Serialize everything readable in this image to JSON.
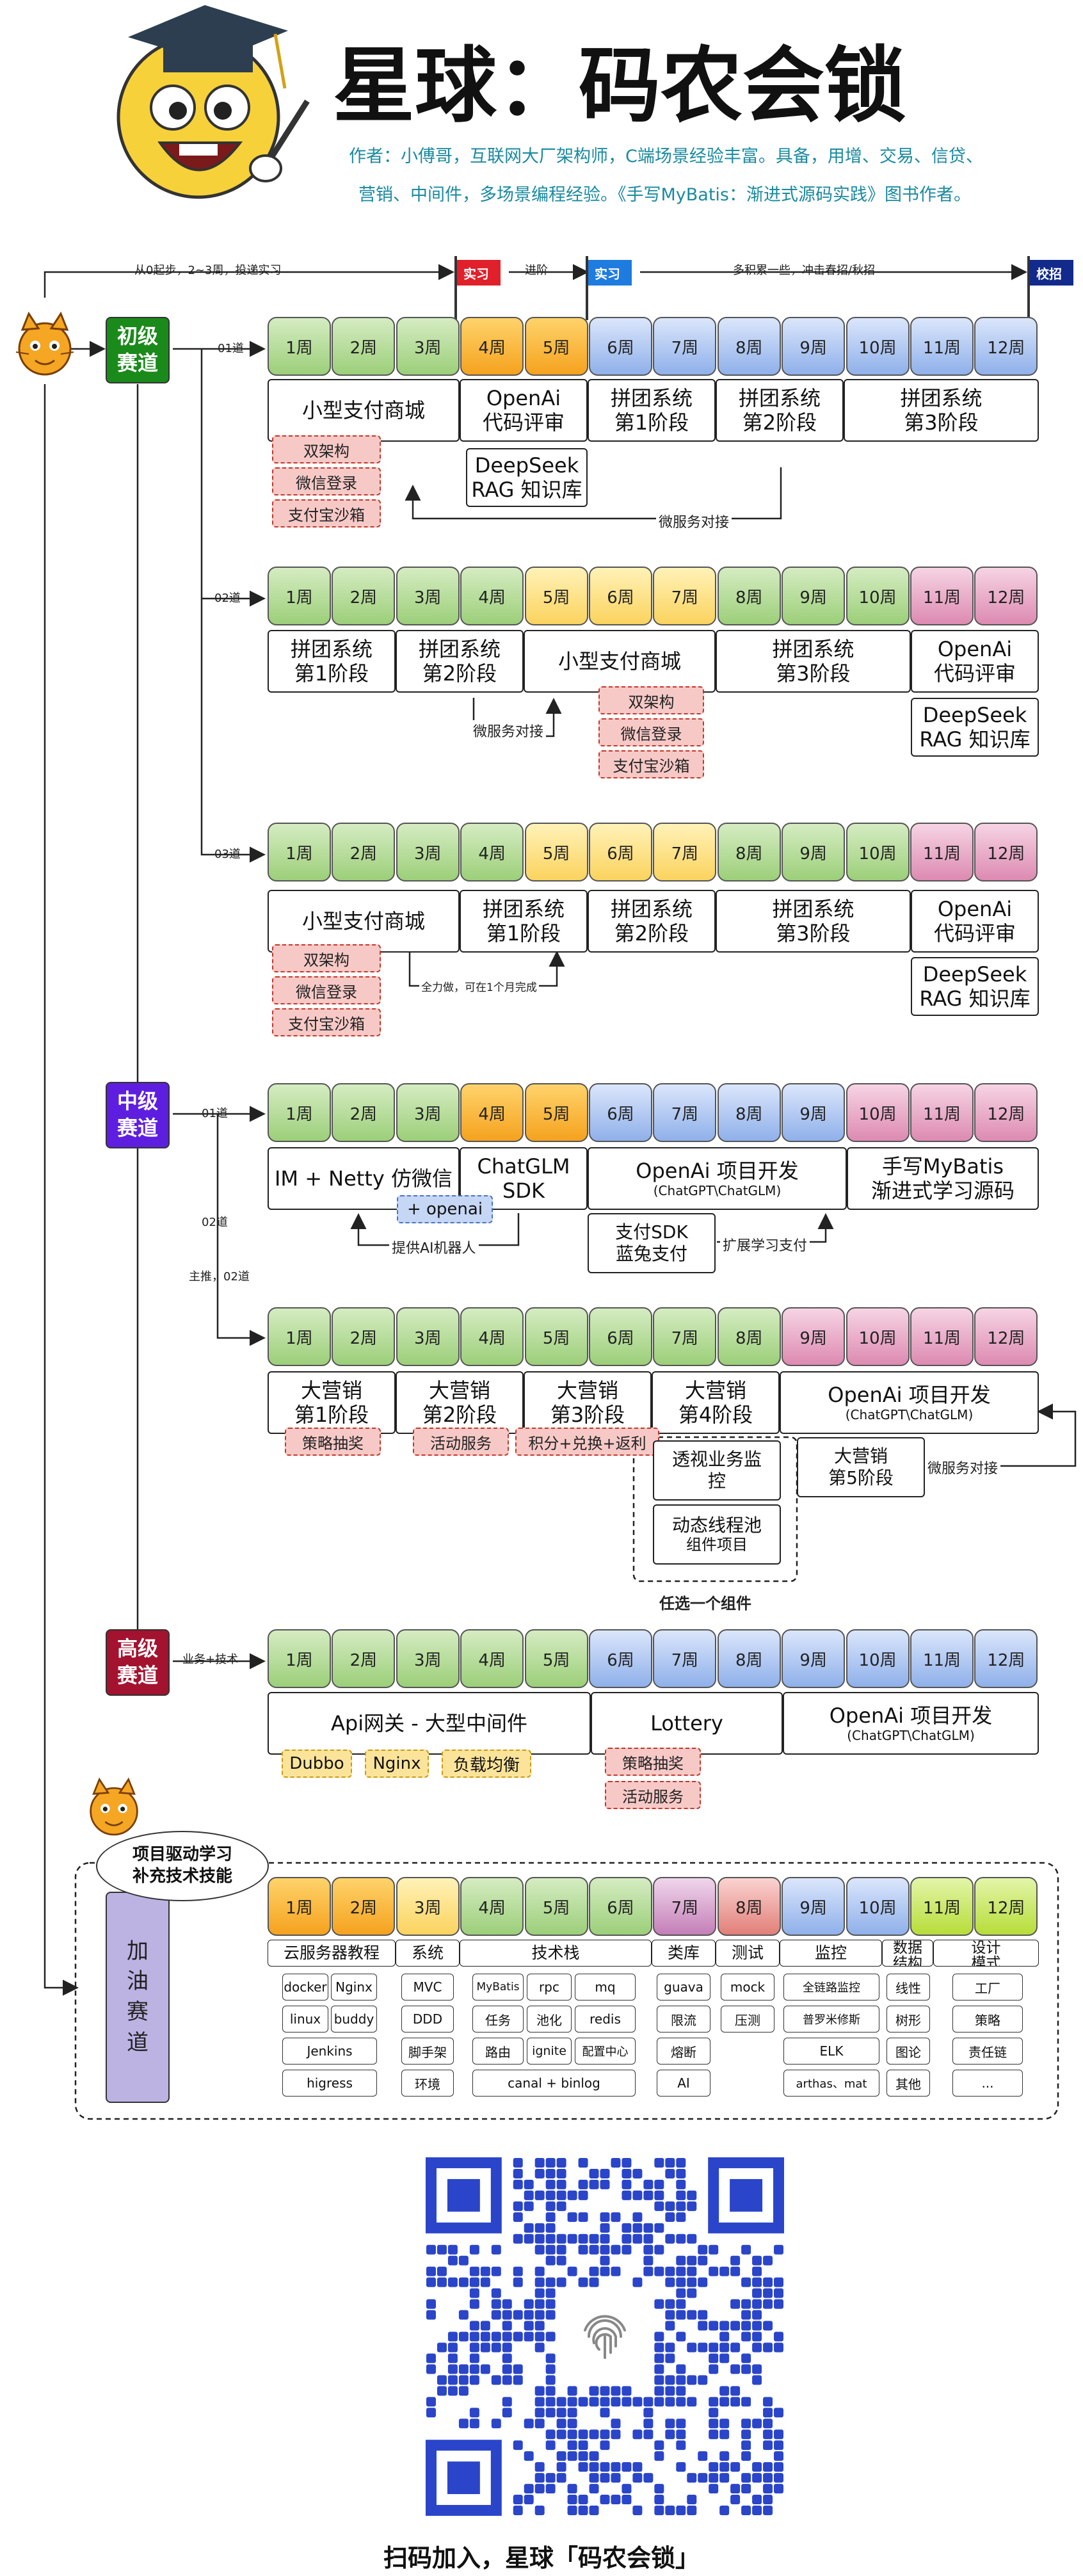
{
  "header": {
    "title": "星球：码农会锁",
    "intro_line1": "作者：小傅哥，互联网大厂架构师，C端场景经验丰富。具备，用增、交易、信贷、",
    "intro_line2": "营销、中间件，多场景编程经验。《手写MyBatis：渐进式源码实践》图书作者。"
  },
  "flags": {
    "intern1": "实习",
    "intern2": "实习",
    "campus": "校招",
    "start_note": "从0起步，2~3周，投递实习",
    "advance_note": "进阶",
    "accum_note": "多积累一些，冲击春招/秋招"
  },
  "tracks": {
    "junior": "初级\n赛道",
    "middle": "中级\n赛道",
    "senior": "高级\n赛道",
    "boost": "加\n油\n赛\n道"
  },
  "route_labels": {
    "j01": "01道",
    "j02": "02道",
    "j03": "03道",
    "m01": "01道",
    "m02": "02道",
    "m_main": "主推，02道",
    "s_note": "业务+技术"
  },
  "weeks": [
    "1周",
    "2周",
    "3周",
    "4周",
    "5周",
    "6周",
    "7周",
    "8周",
    "9周",
    "10周",
    "11周",
    "12周"
  ],
  "junior": {
    "r1": {
      "mall": "小型支付商城",
      "openai": "OpenAi\n代码评审",
      "deepseek": "DeepSeek\nRAG 知识库",
      "pt1": "拼团系统\n第1阶段",
      "pt2": "拼团系统\n第2阶段",
      "pt3": "拼团系统\n第3阶段",
      "tags": [
        "双架构",
        "微信登录",
        "支付宝沙箱"
      ],
      "micro": "微服务对接"
    },
    "r2": {
      "pt1": "拼团系统\n第1阶段",
      "pt2": "拼团系统\n第2阶段",
      "mall": "小型支付商城",
      "pt3": "拼团系统\n第3阶段",
      "openai": "OpenAi\n代码评审",
      "deepseek": "DeepSeek\nRAG 知识库",
      "tags": [
        "双架构",
        "微信登录",
        "支付宝沙箱"
      ],
      "micro": "微服务对接"
    },
    "r3": {
      "mall": "小型支付商城",
      "pt1": "拼团系统\n第1阶段",
      "pt2": "拼团系统\n第2阶段",
      "pt3": "拼团系统\n第3阶段",
      "openai": "OpenAi\n代码评审",
      "deepseek": "DeepSeek\nRAG 知识库",
      "tags": [
        "双架构",
        "微信登录",
        "支付宝沙箱"
      ],
      "note": "全力做，可在1个月完成"
    }
  },
  "middle": {
    "r1": {
      "im": "IM + Netty 仿微信",
      "chatglm": "ChatGLM\nSDK",
      "openai": "OpenAi 项目开发",
      "openai_sub": "(ChatGPT\\ChatGLM)",
      "mybatis": "手写MyBatis\n渐进式学习源码",
      "plus_openai": "+ openai",
      "ai_robot": "提供AI机器人",
      "paysdk": "支付SDK\n蓝兔支付",
      "ext_pay": "扩展学习支付"
    },
    "r2": {
      "m1": "大营销\n第1阶段",
      "m2": "大营销\n第2阶段",
      "m3": "大营销\n第3阶段",
      "m4": "大营销\n第4阶段",
      "openai": "OpenAi 项目开发",
      "openai_sub": "(ChatGPT\\ChatGLM)",
      "tag1": "策略抽奖",
      "tag2": "活动服务",
      "tag3": "积分+兑换+返利",
      "monitor": "透视业务监\n控",
      "threadpool": "动态线程池",
      "threadpool_sub": "组件项目",
      "m5": "大营销\n第5阶段",
      "micro": "微服务对接",
      "choose": "任选一个组件"
    }
  },
  "senior": {
    "api": "Api网关 - 大型中间件",
    "lottery": "Lottery",
    "openai": "OpenAi 项目开发",
    "openai_sub": "(ChatGPT\\ChatGLM)",
    "ytags": [
      "Dubbo",
      "Nginx",
      "负载均衡"
    ],
    "rtags": [
      "策略抽奖",
      "活动服务"
    ]
  },
  "boost": {
    "bubble": "项目驱动学习\n补充技术技能",
    "headers": [
      "云服务器教程",
      "系统",
      "技术栈",
      "类库",
      "测试",
      "监控",
      "数据\n结构",
      "设计\n模式"
    ],
    "cloud": [
      "docker",
      "Nginx",
      "linux",
      "buddy",
      "Jenkins",
      "higress"
    ],
    "system": [
      "MVC",
      "DDD",
      "脚手架",
      "环境"
    ],
    "stack": [
      "MyBatis",
      "rpc",
      "mq",
      "任务",
      "池化",
      "redis",
      "路由",
      "ignite",
      "配置中心",
      "canal + binlog"
    ],
    "lib": [
      "guava",
      "限流",
      "熔断",
      "AI"
    ],
    "test": [
      "mock",
      "压测"
    ],
    "monitor": [
      "全链路监控",
      "普罗米修斯",
      "ELK",
      "arthas、mat"
    ],
    "ds": [
      "线性",
      "树形",
      "图论",
      "其他"
    ],
    "dp": [
      "工厂",
      "策略",
      "责任链",
      "..."
    ]
  },
  "footer": {
    "scan": "扫码加入，星球「码农会锁」"
  },
  "colors": {
    "junior_track": "#1a8a1a",
    "middle_track": "#5e1ee0",
    "senior_track": "#a3122e",
    "boost_track": "#bcb3e3",
    "qr": "#2a45c9"
  }
}
